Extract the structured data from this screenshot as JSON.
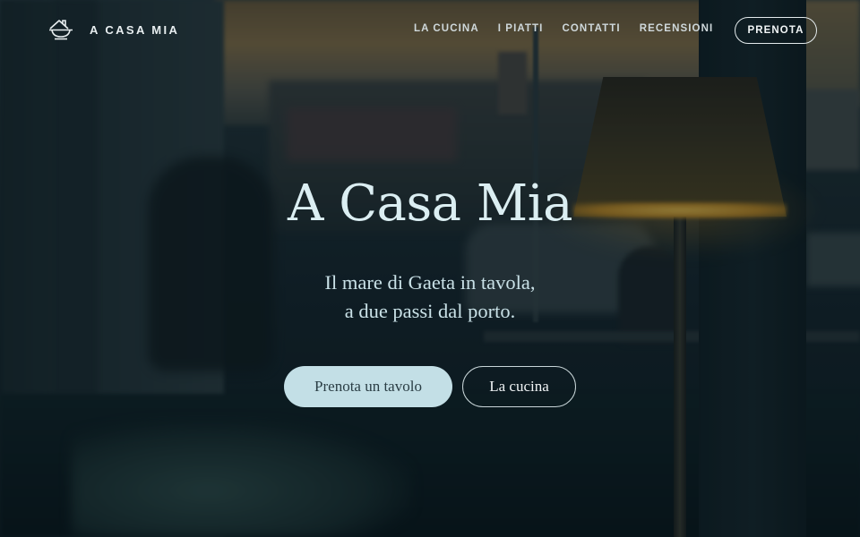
{
  "brand": {
    "name": "A CASA MIA",
    "icon": "house-bowl-icon"
  },
  "nav": {
    "items": [
      {
        "label": "LA CUCINA"
      },
      {
        "label": "I PIATTI"
      },
      {
        "label": "CONTATTI"
      },
      {
        "label": "RECENSIONI"
      }
    ],
    "cta_label": "PRENOTA"
  },
  "hero": {
    "title": "A Casa Mia",
    "subtitle_lines": [
      "Il mare di Gaeta in tavola,",
      "a due passi dal porto."
    ],
    "primary_button": "Prenota un tavolo",
    "secondary_button": "La cucina"
  },
  "colors": {
    "accent": "#c3dfe6",
    "title": "#dbeef2",
    "overlay": "#08161c",
    "lamp_glow": "#f2c24a"
  }
}
